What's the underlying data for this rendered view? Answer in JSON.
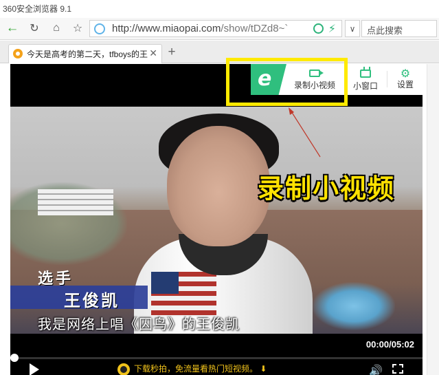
{
  "window": {
    "title": "360安全浏览器 9.1"
  },
  "toolbar": {
    "back_icon": "back-arrow-icon",
    "reload_icon": "reload-icon",
    "home_icon": "home-icon",
    "favorite_icon": "star-icon",
    "url_host": "http://www.miaopai.com",
    "url_path": "/show/tDZd8~`",
    "search_placeholder": "点此搜索"
  },
  "tabs": [
    {
      "label": "今天是高考的第二天，tfboys的王",
      "active": true
    }
  ],
  "player": {
    "toolbar": {
      "logo": "e",
      "record_label": "录制小视频",
      "mini_window_label": "小窗口",
      "settings_label": "设置"
    },
    "video": {
      "overlay_text": "录制小视频",
      "caption_label": "选手",
      "caption_name": "王俊凯",
      "subtitle": "我是网络上唱《囚鸟》的王俊凯"
    },
    "controls": {
      "time": "00:00/05:02",
      "progress": 0.0,
      "promo_text": "下载秒拍，免流量看热门短视频。"
    }
  },
  "colors": {
    "accent_green": "#2fbf7e",
    "highlight_yellow": "#ffea00",
    "promo_gold": "#f0c21b"
  }
}
